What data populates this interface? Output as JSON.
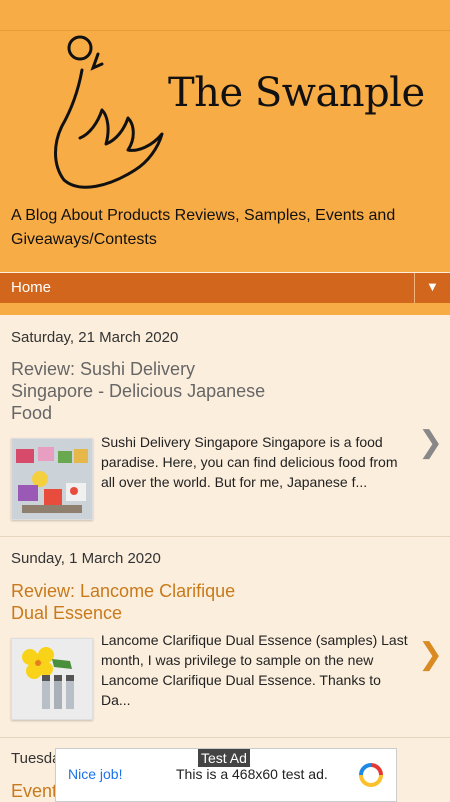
{
  "header": {
    "title": "The Swanple",
    "description": "A Blog About Products Reviews, Samples, Events and Giveaways/Contests"
  },
  "nav": {
    "home_label": "Home",
    "dropdown_icon": "▼"
  },
  "posts": [
    {
      "date": "Saturday, 21 March 2020",
      "title": "Review: Sushi Delivery Singapore - Delicious Japanese Food",
      "title_color": "#666666",
      "snippet": "Sushi Delivery Singapore Singapore is a food paradise. Here, you can find delicious food from all over the world. But for me, Japanese f...",
      "arrow": "❯",
      "arrow_color": "#888888"
    },
    {
      "date": "Sunday, 1 March 2020",
      "title": "Review: Lancome Clarifique Dual Essence",
      "title_color": "#c87a1a",
      "snippet": "Lancome Clarifique Dual Essence (samples) Last month, I was privilege to sample on the new Lancome Clarifique Dual Essence. Thanks to Da...",
      "arrow": "❯",
      "arrow_color": "#d98a23"
    },
    {
      "date": "Tuesday",
      "title": "Event",
      "title_color": "#c87a1a"
    }
  ],
  "ad": {
    "label": "Test Ad",
    "nice": "Nice job!",
    "text": "This is a 468x60 test ad."
  }
}
